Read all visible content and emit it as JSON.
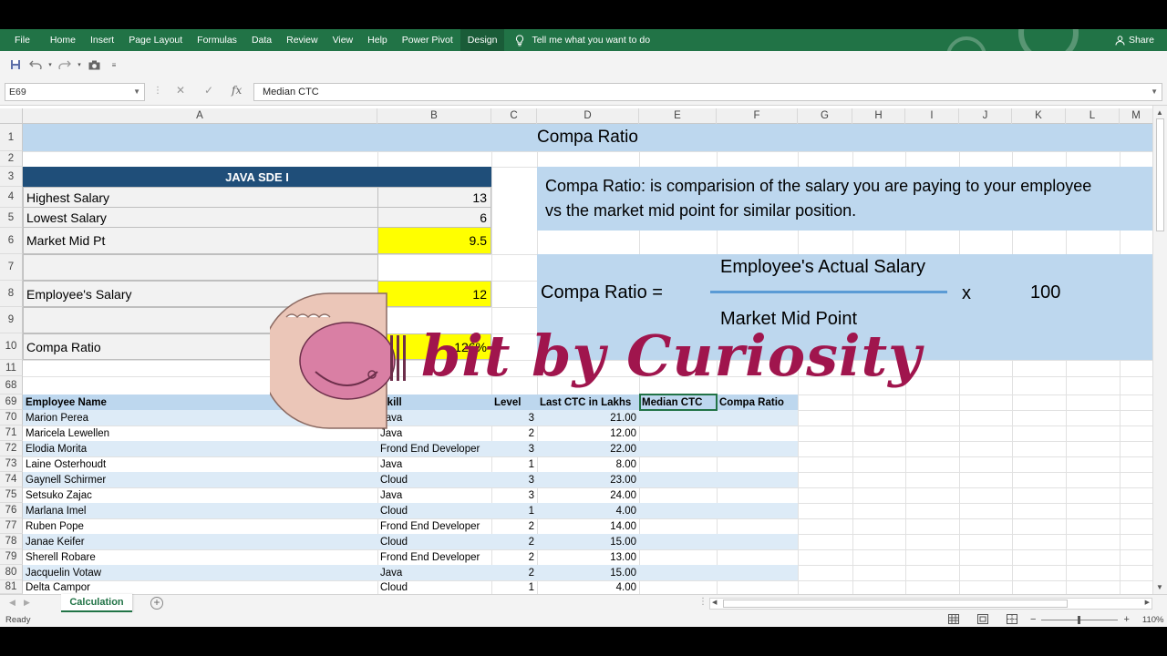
{
  "ribbon": {
    "tabs": [
      "File",
      "Home",
      "Insert",
      "Page Layout",
      "Formulas",
      "Data",
      "Review",
      "View",
      "Help",
      "Power Pivot",
      "Design"
    ],
    "active_tab": "Design",
    "tell_me": "Tell me what you want to do",
    "share": "Share"
  },
  "formula_bar": {
    "name_box": "E69",
    "content": "Median CTC"
  },
  "columns": [
    "A",
    "B",
    "C",
    "D",
    "E",
    "F",
    "G",
    "H",
    "I",
    "J",
    "K",
    "L",
    "M"
  ],
  "rows": [
    "1",
    "2",
    "3",
    "4",
    "5",
    "6",
    "7",
    "8",
    "9",
    "10",
    "11",
    "68",
    "69",
    "70",
    "71",
    "72",
    "73",
    "74",
    "75",
    "76",
    "77",
    "78",
    "79",
    "80",
    "81"
  ],
  "summary": {
    "title": "Compa Ratio",
    "block_header": "JAVA SDE I",
    "highest_label": "Highest Salary",
    "highest_value": "13",
    "lowest_label": "Lowest Salary",
    "lowest_value": "6",
    "midpt_label": "Market Mid Pt",
    "midpt_value": "9.5",
    "emp_label": "Employee's Salary",
    "emp_value": "12",
    "compa_label": "Compa Ratio",
    "compa_value": "126%"
  },
  "definition": {
    "line1": "Compa Ratio: is comparision of the salary you are paying to your employee",
    "line2": "vs the market mid point for similar position."
  },
  "formula": {
    "lhs": "Compa Ratio =",
    "numerator": "Employee's Actual Salary",
    "denominator": "Market Mid Point",
    "times": "x",
    "multiplier": "100"
  },
  "table": {
    "headers": [
      "Employee Name",
      "Skill",
      "Level",
      "Last CTC in Lakhs",
      "Median CTC",
      "Compa Ratio"
    ],
    "rows": [
      {
        "name": "Marion Perea",
        "skill": "Java",
        "level": "3",
        "ctc": "21.00"
      },
      {
        "name": "Maricela Lewellen",
        "skill": "Java",
        "level": "2",
        "ctc": "12.00"
      },
      {
        "name": "Elodia Morita",
        "skill": "Frond End Developer",
        "level": "3",
        "ctc": "22.00"
      },
      {
        "name": "Laine Osterhoudt",
        "skill": "Java",
        "level": "1",
        "ctc": "8.00"
      },
      {
        "name": "Gaynell Schirmer",
        "skill": "Cloud",
        "level": "3",
        "ctc": "23.00"
      },
      {
        "name": "Setsuko Zajac",
        "skill": "Java",
        "level": "3",
        "ctc": "24.00"
      },
      {
        "name": "Marlana Imel",
        "skill": "Cloud",
        "level": "1",
        "ctc": "4.00"
      },
      {
        "name": "Ruben Pope",
        "skill": "Frond End Developer",
        "level": "2",
        "ctc": "14.00"
      },
      {
        "name": "Janae Keifer",
        "skill": "Cloud",
        "level": "2",
        "ctc": "15.00"
      },
      {
        "name": "Sherell Robare",
        "skill": "Frond End Developer",
        "level": "2",
        "ctc": "13.00"
      },
      {
        "name": "Jacquelin Votaw",
        "skill": "Java",
        "level": "2",
        "ctc": "15.00"
      },
      {
        "name": "Delta Campor",
        "skill": "Cloud",
        "level": "1",
        "ctc": "4.00"
      }
    ]
  },
  "sheet_tab": "Calculation",
  "status": {
    "ready": "Ready",
    "zoom": "110%"
  },
  "watermark": "bit by Curiosity",
  "colors": {
    "excel_green": "#217346",
    "band_blue": "#bdd7ee",
    "header_navy": "#1f4e79",
    "highlight_yellow": "#ffff00",
    "watermark_magenta": "#a0154d"
  }
}
